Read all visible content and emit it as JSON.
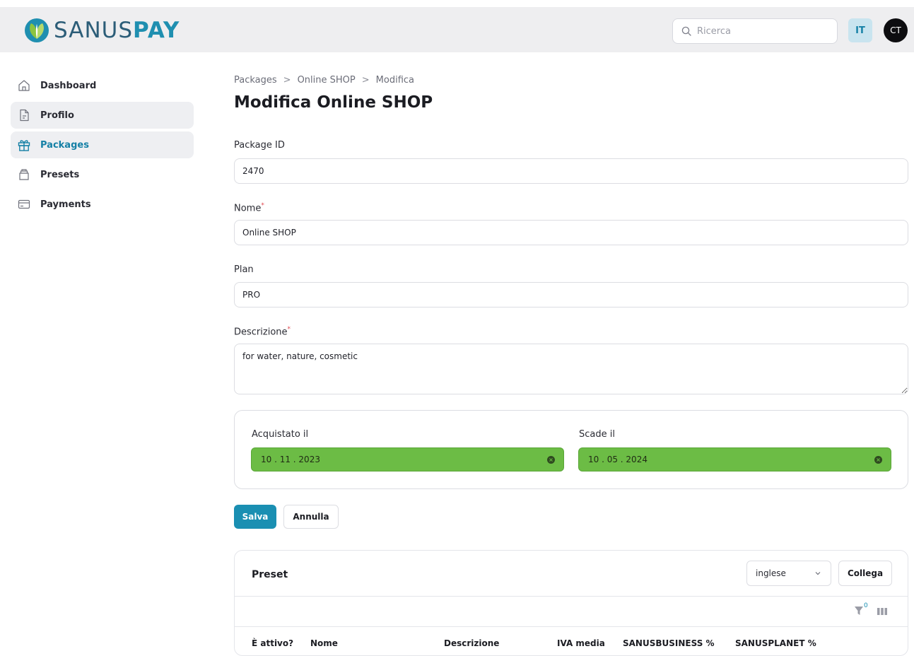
{
  "brand": {
    "name_part1": "SANUS",
    "name_part2": "PAY",
    "colors": {
      "primary": "#1a8fb2",
      "logo_dark": "#2c5d78",
      "leaf_green": "#8cc43f"
    }
  },
  "header": {
    "search_placeholder": "Ricerca",
    "language": "IT",
    "user_initials": "CT"
  },
  "sidebar": {
    "items": [
      {
        "label": "Dashboard",
        "icon": "home-icon"
      },
      {
        "label": "Profilo",
        "icon": "document-icon"
      },
      {
        "label": "Packages",
        "icon": "gift-icon",
        "active": true
      },
      {
        "label": "Presets",
        "icon": "box-icon"
      },
      {
        "label": "Payments",
        "icon": "card-icon"
      }
    ]
  },
  "breadcrumb": [
    "Packages",
    "Online SHOP",
    "Modifica"
  ],
  "page_title": "Modifica Online SHOP",
  "form": {
    "package_id": {
      "label": "Package ID",
      "value": "2470"
    },
    "nome": {
      "label": "Nome",
      "value": "Online SHOP",
      "required": true
    },
    "plan": {
      "label": "Plan",
      "value": "PRO"
    },
    "descrizione": {
      "label": "Descrizione",
      "value": "for water, nature, cosmetic",
      "required": true
    },
    "acquistato_il": {
      "label": "Acquistato il",
      "value": "10 . 11 . 2023"
    },
    "scade_il": {
      "label": "Scade il",
      "value": "10 . 05 . 2024"
    },
    "date_field_color": "#6cbc45"
  },
  "actions": {
    "save": "Salva",
    "cancel": "Annulla"
  },
  "preset": {
    "title": "Preset",
    "language_select": "inglese",
    "link_button": "Collega",
    "filter_count": "0",
    "columns": [
      "È attivo?",
      "Nome",
      "Descrizione",
      "IVA media",
      "SANUSBUSINESS %",
      "SANUSPLANET %"
    ]
  }
}
